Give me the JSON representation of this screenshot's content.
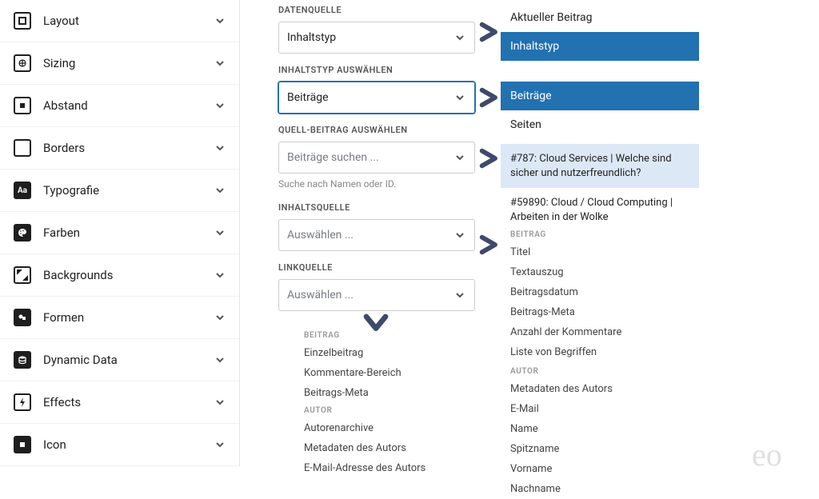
{
  "sidebar": {
    "items": [
      {
        "label": "Layout"
      },
      {
        "label": "Sizing"
      },
      {
        "label": "Abstand"
      },
      {
        "label": "Borders"
      },
      {
        "label": "Typografie"
      },
      {
        "label": "Farben"
      },
      {
        "label": "Backgrounds"
      },
      {
        "label": "Formen"
      },
      {
        "label": "Dynamic Data"
      },
      {
        "label": "Effects"
      },
      {
        "label": "Icon"
      }
    ]
  },
  "panel": {
    "datenquelle": {
      "label": "DATENQUELLE",
      "value": "Inhaltstyp"
    },
    "inhaltstyp": {
      "label": "INHALTSTYP AUSWÄHLEN",
      "value": "Beiträge"
    },
    "quellbeitrag": {
      "label": "QUELL-BEITRAG AUSWÄHLEN",
      "placeholder": "Beiträge suchen ...",
      "helper": "Suche nach Namen oder ID."
    },
    "inhaltsquelle": {
      "label": "INHALTSQUELLE",
      "placeholder": "Auswählen ..."
    },
    "linkquelle": {
      "label": "LINKQUELLE",
      "placeholder": "Auswählen ..."
    }
  },
  "flyouts": {
    "datenquelle": [
      {
        "label": "Aktueller Beitrag",
        "selected": false
      },
      {
        "label": "Inhaltstyp",
        "selected": true
      }
    ],
    "inhaltstyp": [
      {
        "label": "Beiträge",
        "selected": true
      },
      {
        "label": "Seiten",
        "selected": false
      }
    ],
    "quellbeitrag": [
      {
        "label": "#787: Cloud Services | Welche sind sicher und nutzerfreundlich?",
        "highlight": true
      },
      {
        "label": "#59890: Cloud / Cloud Computing | Arbeiten in der Wolke"
      }
    ],
    "inhaltsquelle": {
      "groups": [
        {
          "title": "BEITRAG",
          "items": [
            "Titel",
            "Textauszug",
            "Beitragsdatum",
            "Beitrags-Meta",
            "Anzahl der Kommentare",
            "Liste von Begriffen"
          ]
        },
        {
          "title": "AUTOR",
          "items": [
            "Metadaten des Autors",
            "E-Mail",
            "Name",
            "Spitzname",
            "Vorname",
            "Nachname"
          ]
        }
      ]
    },
    "linkquelle": {
      "groups": [
        {
          "title": "BEITRAG",
          "items": [
            "Einzelbeitrag",
            "Kommentare-Bereich",
            "Beitrags-Meta"
          ]
        },
        {
          "title": "AUTOR",
          "items": [
            "Autorenarchive",
            "Metadaten des Autors",
            "E-Mail-Adresse des Autors"
          ]
        }
      ]
    }
  }
}
